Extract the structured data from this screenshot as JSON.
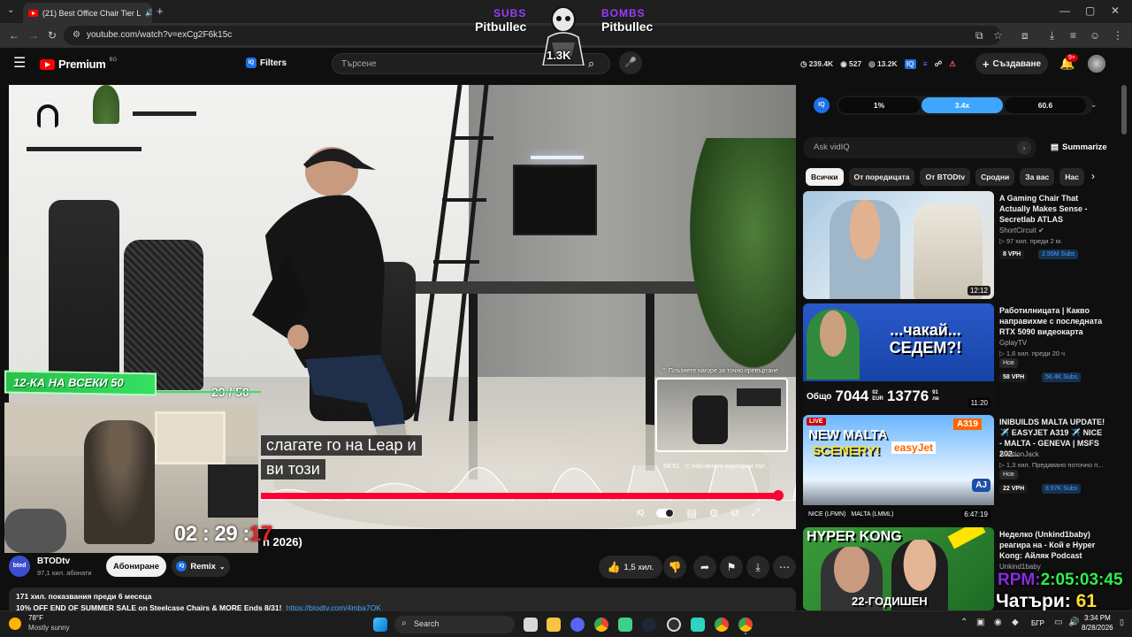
{
  "browser": {
    "tab_title": "(21) Best Office Chair Tier L",
    "new_tab": "+",
    "url": "youtube.com/watch?v=exCg2F6k15c"
  },
  "stream_overlay": {
    "subs_label": "SUBS",
    "subs_name": "Pitbullec",
    "bombs_label": "BOMBS",
    "bombs_name": "Pitbullec",
    "goal_count": "1.3K",
    "counter_title": "12-КА НА ВСЕКИ 50",
    "counter_value": "29 / 50",
    "timer": "02 : 29 :",
    "timer_last": "17",
    "rpm_label": "RPM:",
    "rpm_time": "2:05:03:45",
    "chat_label": "Чатъри:",
    "chat_value": "61"
  },
  "youtube": {
    "logo_text": "Premium",
    "logo_region": "BG",
    "filters_label": "Filters",
    "search_placeholder": "Търсене",
    "stats": {
      "views": "239.4K",
      "likes": "527",
      "eyes": "13.2K"
    },
    "create_label": "Създаване",
    "notif_count": "9+"
  },
  "player": {
    "subtitle_line1": "слагате го на Leap и",
    "subtitle_line2": "ви този",
    "seek_hint": "Плъзнете нагоре за точно превъртане",
    "preview_time": "58:51",
    "preview_text": "С най-много повторни пус...",
    "title_fragment": "n 2026)"
  },
  "channel": {
    "avatar_text": "bted",
    "name": "BTODtv",
    "subs": "97,1 хил. абонати",
    "subscribe_label": "Абониране",
    "remix_label": "Remix",
    "likes": "1,5 хил."
  },
  "description": {
    "meta": "171 хил. показвания  преди 6 месеца",
    "line": "10% OFF END OF SUMMER SALE on Steelcase Chairs & MORE Ends 8/31!",
    "link": "https://btodtv.com/4mba7OK"
  },
  "vidiq": {
    "logo": "IQ",
    "metric1": "1%",
    "metric2": "3.4x",
    "metric3": "60.6",
    "ask_placeholder": "Ask vidIQ",
    "summarize_label": "Summarize"
  },
  "chips": [
    "Всички",
    "От поредицата",
    "От BTODtv",
    "Сродни",
    "За вас",
    "Нас"
  ],
  "recommendations": [
    {
      "title": "A Gaming Chair That Actually Makes Sense - Secretlab ATLAS",
      "channel": "ShortCircuit",
      "meta": "▷ 97 хил.  преди 2 м.",
      "vph": "8 VPH",
      "subs": "2.55M Subs",
      "duration": "12:12"
    },
    {
      "title": "Работилницата | Какво направихме с последната RTX 5090 видеокарта",
      "channel": "GplayTV",
      "meta": "▷ 1,6 хил.  преди 20 ч",
      "tag": "Нов",
      "vph": "58 VPH",
      "subs": "56.4K Subs",
      "duration": "11:20",
      "thumb_text": "...чакай... СЕДЕМ?!",
      "thumb_total_label": "Общо",
      "thumb_left_num": "7044",
      "thumb_left_cents": "02",
      "thumb_left_cur": "EUR",
      "thumb_right_num": "13776",
      "thumb_right_cents": "91",
      "thumb_right_cur": "лв"
    },
    {
      "title": "INIBUILDS MALTA UPDATE! ✈️ EASYJET A319 ✈️ NICE - MALTA - GENEVA | MSFS 202...",
      "channel": "AviationJack",
      "meta": "▷ 1,3 хил.  Предавано поточно п...",
      "tag": "Нов",
      "vph": "22 VPH",
      "subs": "8.97K Subs",
      "duration": "6:47:19",
      "live": "LIVE",
      "thumb_text1": "NEW MALTA",
      "thumb_text2": "SCENERY!",
      "thumb_badge": "A319",
      "thumb_airline": "easyJet",
      "thumb_from": "NICE (LFMN)",
      "thumb_to": "MALTA (LMML)",
      "thumb_corner": "AJ"
    },
    {
      "title": "Неделко (Unkind1baby) реагира на - Кой е Hyper Kong: Айляк Podcast",
      "channel": "Unkind1baby",
      "thumb_text": "22-ГОДИШЕН",
      "thumb_top": "HYPER KONG"
    }
  ],
  "taskbar": {
    "temp": "78°F",
    "weather": "Mostly sunny",
    "search": "Search",
    "lang": "БГР",
    "time": "3:34 PM",
    "date": "8/28/2026"
  }
}
